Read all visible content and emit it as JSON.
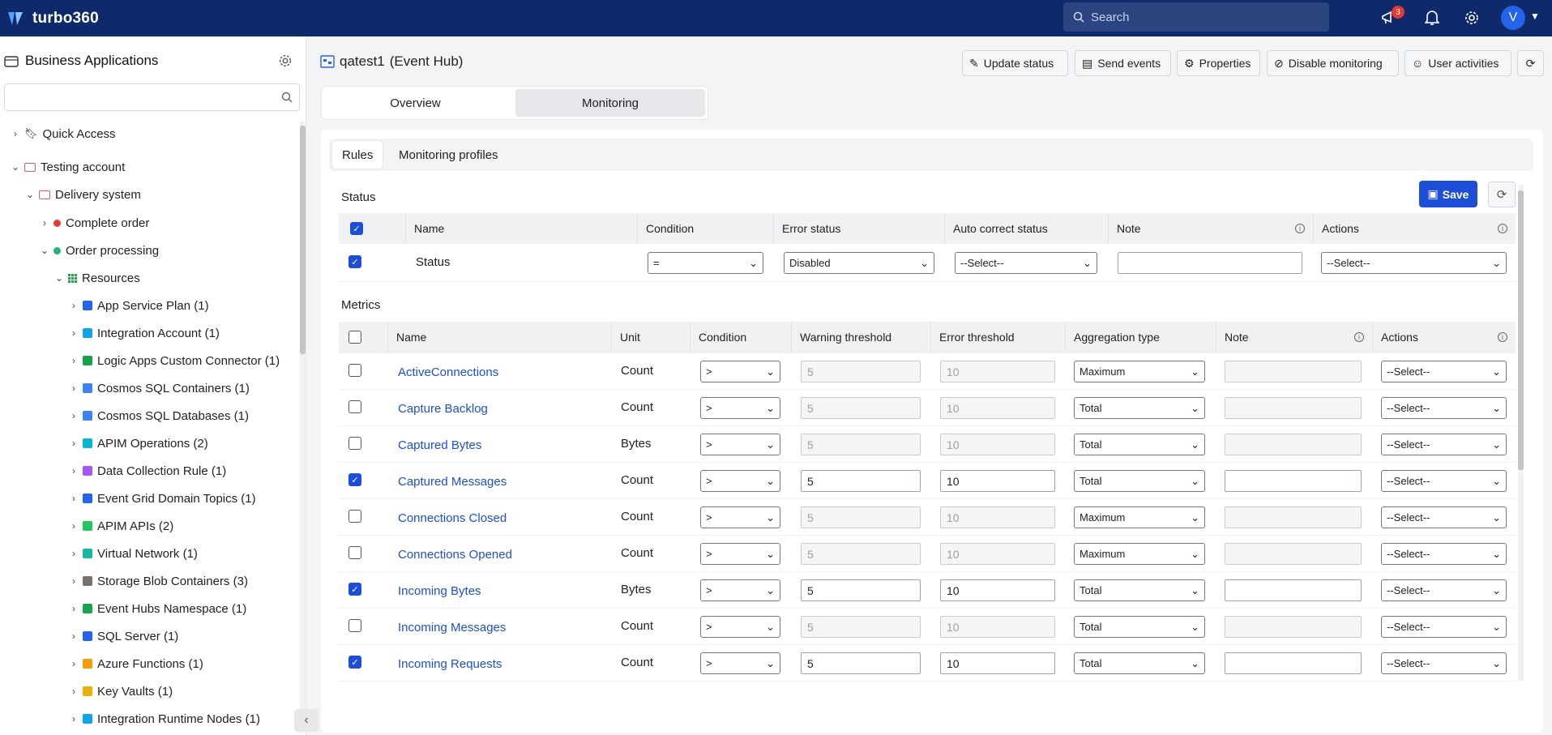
{
  "app": {
    "name": "turbo360",
    "search_placeholder": "Search",
    "notif_count": "3",
    "avatar": "V"
  },
  "sidebar": {
    "title": "Business Applications",
    "quick_access": "Quick Access",
    "account": "Testing account",
    "system": "Delivery system",
    "complete_order": "Complete order",
    "order_processing": "Order processing",
    "resources": "Resources",
    "items": [
      {
        "label": "App Service Plan (1)",
        "color": "#2563eb"
      },
      {
        "label": "Integration Account (1)",
        "color": "#0ea5e9"
      },
      {
        "label": "Logic Apps Custom Connector (1)",
        "color": "#16a34a"
      },
      {
        "label": "Cosmos SQL Containers (1)",
        "color": "#3b82f6"
      },
      {
        "label": "Cosmos SQL Databases (1)",
        "color": "#3b82f6"
      },
      {
        "label": "APIM Operations (2)",
        "color": "#06b6d4"
      },
      {
        "label": "Data Collection Rule (1)",
        "color": "#a855f7"
      },
      {
        "label": "Event Grid Domain Topics (1)",
        "color": "#2563eb"
      },
      {
        "label": "APIM APIs (2)",
        "color": "#22c55e"
      },
      {
        "label": "Virtual Network (1)",
        "color": "#14b8a6"
      },
      {
        "label": "Storage Blob Containers (3)",
        "color": "#78716c"
      },
      {
        "label": "Event Hubs Namespace (1)",
        "color": "#16a34a"
      },
      {
        "label": "SQL Server (1)",
        "color": "#2563eb"
      },
      {
        "label": "Azure Functions (1)",
        "color": "#f59e0b"
      },
      {
        "label": "Key Vaults (1)",
        "color": "#eab308"
      },
      {
        "label": "Integration Runtime Nodes (1)",
        "color": "#0ea5e9"
      }
    ]
  },
  "header": {
    "resource_name": "qatest1",
    "resource_type": "(Event Hub)",
    "buttons": [
      "Update status",
      "Send events",
      "Properties",
      "Disable monitoring",
      "User activities"
    ]
  },
  "tabs": [
    "Overview",
    "Monitoring"
  ],
  "subtabs": [
    "Rules",
    "Monitoring profiles"
  ],
  "status_section": {
    "label": "Status",
    "save": "Save",
    "columns": [
      "Name",
      "Condition",
      "Error status",
      "Auto correct status",
      "Note",
      "Actions"
    ],
    "row": {
      "name": "Status",
      "condition": "=",
      "error_status": "Disabled",
      "auto_correct": "--Select--",
      "note": "",
      "actions": "--Select--"
    }
  },
  "metrics_section": {
    "label": "Metrics",
    "columns": [
      "Name",
      "Unit",
      "Condition",
      "Warning threshold",
      "Error threshold",
      "Aggregation type",
      "Note",
      "Actions"
    ],
    "rows": [
      {
        "name": "ActiveConnections",
        "unit": "Count",
        "checked": false,
        "condition": ">",
        "warning": "5",
        "error": "10",
        "aggregation": "Maximum",
        "actions": "--Select--"
      },
      {
        "name": "Capture Backlog",
        "unit": "Count",
        "checked": false,
        "condition": ">",
        "warning": "5",
        "error": "10",
        "aggregation": "Total",
        "actions": "--Select--"
      },
      {
        "name": "Captured Bytes",
        "unit": "Bytes",
        "checked": false,
        "condition": ">",
        "warning": "5",
        "error": "10",
        "aggregation": "Total",
        "actions": "--Select--"
      },
      {
        "name": "Captured Messages",
        "unit": "Count",
        "checked": true,
        "condition": ">",
        "warning": "5",
        "error": "10",
        "aggregation": "Total",
        "actions": "--Select--"
      },
      {
        "name": "Connections Closed",
        "unit": "Count",
        "checked": false,
        "condition": ">",
        "warning": "5",
        "error": "10",
        "aggregation": "Maximum",
        "actions": "--Select--"
      },
      {
        "name": "Connections Opened",
        "unit": "Count",
        "checked": false,
        "condition": ">",
        "warning": "5",
        "error": "10",
        "aggregation": "Maximum",
        "actions": "--Select--"
      },
      {
        "name": "Incoming Bytes",
        "unit": "Bytes",
        "checked": true,
        "condition": ">",
        "warning": "5",
        "error": "10",
        "aggregation": "Total",
        "actions": "--Select--"
      },
      {
        "name": "Incoming Messages",
        "unit": "Count",
        "checked": false,
        "condition": ">",
        "warning": "5",
        "error": "10",
        "aggregation": "Total",
        "actions": "--Select--"
      },
      {
        "name": "Incoming Requests",
        "unit": "Count",
        "checked": true,
        "condition": ">",
        "warning": "5",
        "error": "10",
        "aggregation": "Total",
        "actions": "--Select--"
      }
    ]
  }
}
